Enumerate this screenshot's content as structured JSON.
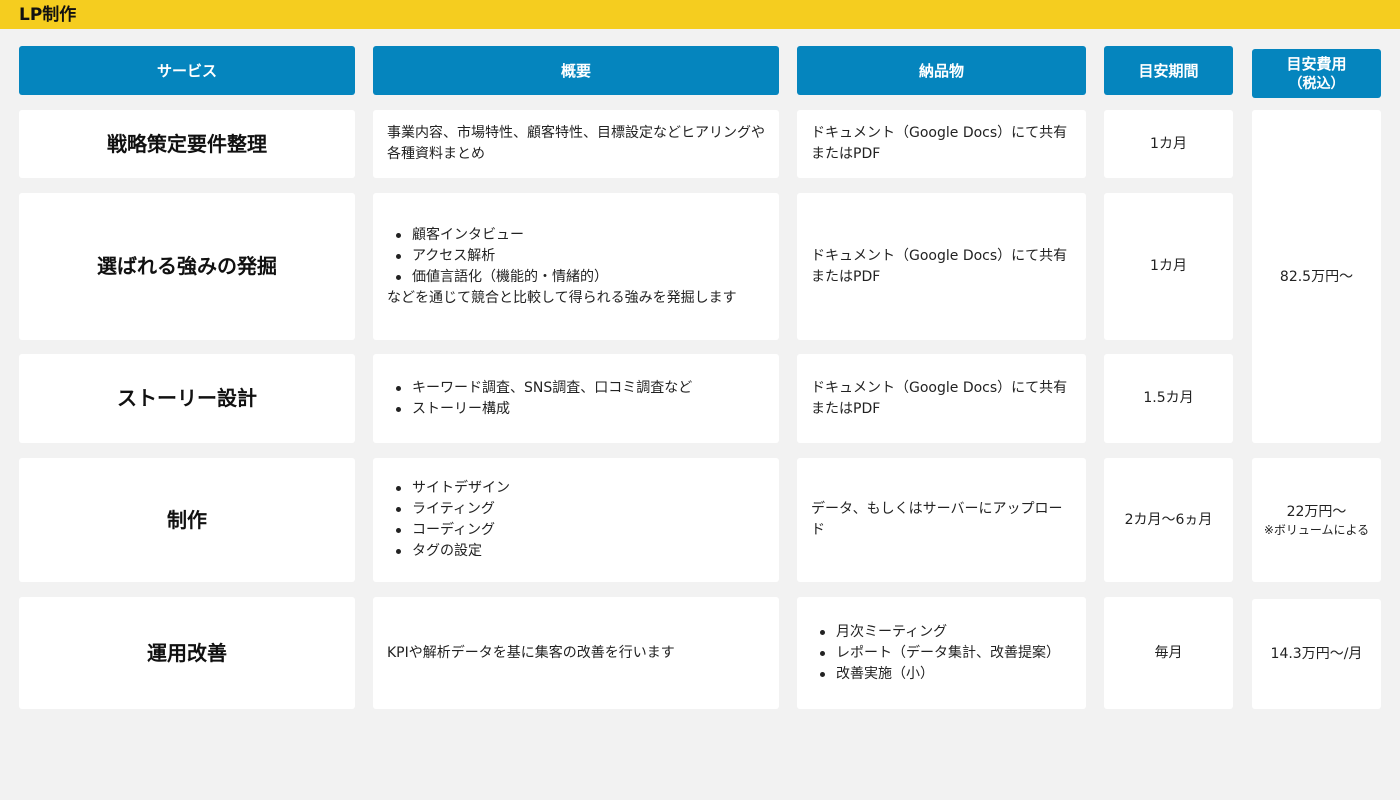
{
  "page": {
    "title": "LP制作"
  },
  "headers": {
    "service": "サービス",
    "overview": "概要",
    "deliverable": "納品物",
    "period": "目安期間",
    "cost_line1": "目安費用",
    "cost_line2": "（税込）"
  },
  "colors": {
    "accent_bar": "#f5cd1f",
    "header_bg": "#0585be"
  },
  "rows": [
    {
      "service": "戦略策定要件整理",
      "overview": "事業内容、市場特性、顧客特性、目標設定などヒアリングや各種資料まとめ",
      "deliverable": "ドキュメント（Google Docs）にて共有またはPDF",
      "period": "1カ月"
    },
    {
      "service": "選ばれる強みの発掘",
      "overview_items": [
        "顧客インタビュー",
        "アクセス解析",
        "価値言語化（機能的・情緒的）"
      ],
      "overview_after": "などを通じて競合と比較して得られる強みを発掘します",
      "deliverable": "ドキュメント（Google Docs）にて共有またはPDF",
      "period": "1カ月"
    },
    {
      "service": "ストーリー設計",
      "overview_items": [
        "キーワード調査、SNS調査、口コミ調査など",
        "ストーリー構成"
      ],
      "deliverable": "ドキュメント（Google Docs）にて共有またはPDF",
      "period": "1.5カ月"
    },
    {
      "service": "制作",
      "overview_items": [
        "サイトデザイン",
        "ライティング",
        "コーディング",
        "タグの設定"
      ],
      "deliverable": "データ、もしくはサーバーにアップロード",
      "period": "2カ月〜6ヵ月"
    },
    {
      "service": "運用改善",
      "overview": "KPIや解析データを基に集客の改善を行います",
      "deliverable_items": [
        "月次ミーティング",
        "レポート（データ集計、改善提案）",
        "改善実施（小）"
      ],
      "period": "毎月"
    }
  ],
  "prices": {
    "strategy_group": "82.5万円〜",
    "production": "22万円〜",
    "production_note": "※ボリュームによる",
    "operation": "14.3万円〜/月"
  }
}
